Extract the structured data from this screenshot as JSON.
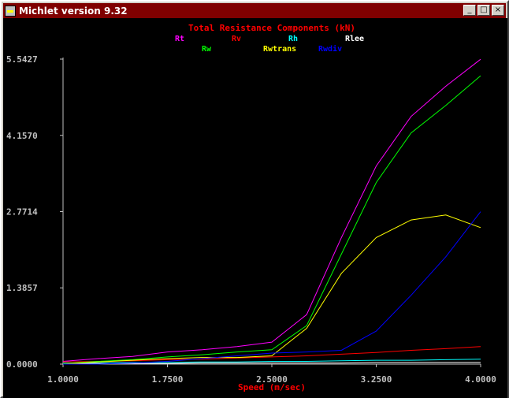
{
  "window": {
    "title": "Michlet version 9.32",
    "buttons": [
      "_",
      "□",
      "×"
    ]
  },
  "colors": {
    "title": "#ff0000",
    "axis": "#c0c0c0",
    "axis_label": "#ff0000",
    "Rt": "#ff00ff",
    "Rv": "#ff0000",
    "Rh": "#00ffff",
    "Rlee": "#ffffff",
    "Rw": "#00ff00",
    "Rwtrans": "#ffff00",
    "Rwdiv": "#0000ff"
  },
  "chart_data": {
    "type": "line",
    "title": "Total Resistance Components (kN)",
    "xlabel": "Speed (m/sec)",
    "ylabel": "",
    "xlim": [
      1.0,
      4.0
    ],
    "ylim": [
      0.0,
      5.5427
    ],
    "x_ticks": [
      "1.0000",
      "1.7500",
      "2.5000",
      "3.2500",
      "4.0000"
    ],
    "y_ticks": [
      "0.0000",
      "1.3857",
      "2.7714",
      "4.1570",
      "5.5427"
    ],
    "x_tick_values": [
      1.0,
      1.75,
      2.5,
      3.25,
      4.0
    ],
    "y_tick_values": [
      0.0,
      1.3857,
      2.7714,
      4.157,
      5.5427
    ],
    "legend": [
      "Rt",
      "Rv",
      "Rh",
      "Rlee",
      "Rw",
      "Rwtrans",
      "Rwdiv"
    ],
    "legend_rows": [
      [
        "Rt",
        "Rv",
        "Rh",
        "Rlee"
      ],
      [
        "Rw",
        "Rwtrans",
        "Rwdiv"
      ]
    ],
    "x": [
      1.0,
      1.25,
      1.5,
      1.75,
      2.0,
      2.25,
      2.5,
      2.75,
      3.0,
      3.25,
      3.5,
      3.75,
      4.0
    ],
    "series": [
      {
        "name": "Rt",
        "values": [
          0.05,
          0.1,
          0.14,
          0.22,
          0.26,
          0.32,
          0.4,
          0.9,
          2.3,
          3.6,
          4.5,
          5.05,
          5.54
        ]
      },
      {
        "name": "Rv",
        "values": [
          0.04,
          0.05,
          0.06,
          0.08,
          0.09,
          0.11,
          0.13,
          0.15,
          0.18,
          0.21,
          0.25,
          0.28,
          0.32
        ]
      },
      {
        "name": "Rh",
        "values": [
          0.02,
          0.02,
          0.03,
          0.03,
          0.04,
          0.04,
          0.05,
          0.05,
          0.06,
          0.07,
          0.07,
          0.08,
          0.09
        ]
      },
      {
        "name": "Rlee",
        "values": [
          0.01,
          0.01,
          0.01,
          0.01,
          0.02,
          0.02,
          0.02,
          0.02,
          0.02,
          0.03,
          0.03,
          0.03,
          0.03
        ]
      },
      {
        "name": "Rw",
        "values": [
          0.01,
          0.05,
          0.08,
          0.13,
          0.17,
          0.22,
          0.26,
          0.7,
          2.0,
          3.3,
          4.2,
          4.7,
          5.24
        ]
      },
      {
        "name": "Rwtrans",
        "values": [
          0.0,
          0.04,
          0.07,
          0.1,
          0.12,
          0.12,
          0.15,
          0.65,
          1.65,
          2.3,
          2.62,
          2.71,
          2.48
        ]
      },
      {
        "name": "Rwdiv",
        "values": [
          0.0,
          0.0,
          0.02,
          0.05,
          0.1,
          0.15,
          0.2,
          0.22,
          0.25,
          0.6,
          1.25,
          1.95,
          2.77
        ]
      }
    ]
  }
}
